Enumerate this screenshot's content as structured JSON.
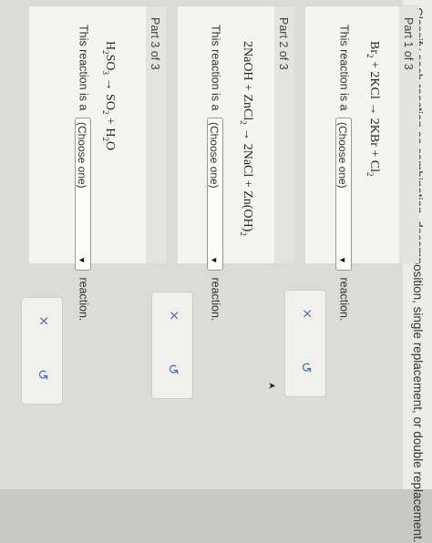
{
  "instruction": "Classify each reaction as combination, decomposition, single replacement, or double replacement.",
  "parts": [
    {
      "title": "Part 1 of 3",
      "equation": {
        "reactants": [
          "Br",
          "2",
          "2KCl"
        ],
        "products": [
          "2KBr",
          "Cl",
          "2"
        ]
      },
      "prompt_before": "This reaction is a",
      "select_placeholder": "(Choose one)",
      "prompt_after": "reaction."
    },
    {
      "title": "Part 2 of 3",
      "equation": {
        "reactants": [
          "2NaOH",
          "ZnCl",
          "2"
        ],
        "products": [
          "2NaCl",
          "Zn(OH)",
          "2"
        ]
      },
      "prompt_before": "This reaction is a",
      "select_placeholder": "(Choose one)",
      "prompt_after": "reaction."
    },
    {
      "title": "Part 3 of 3",
      "equation": {
        "reactants": [
          "H",
          "2",
          "SO",
          "3"
        ],
        "products": [
          "SO",
          "2",
          "H",
          "2",
          "O"
        ]
      },
      "prompt_before": "This reaction is a",
      "select_placeholder": "(Choose one)",
      "prompt_after": "reaction."
    }
  ],
  "tools": {
    "clear_glyph": "×",
    "undo_glyph": "↺"
  },
  "icons": [
    "close-icon",
    "undo-icon",
    "caret-down-icon",
    "cursor-icon"
  ]
}
